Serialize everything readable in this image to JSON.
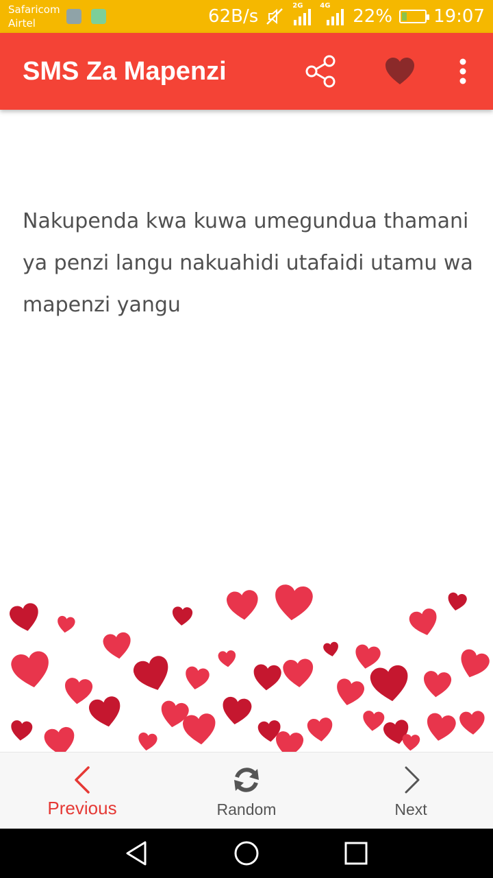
{
  "status_bar": {
    "carrier_1": "Safaricom",
    "carrier_2": "Airtel",
    "speed": "62B/s",
    "net_2g": "2G",
    "net_4g": "4G",
    "battery_percent": "22%",
    "battery_level": 0.22,
    "time": "19:07"
  },
  "app_bar": {
    "title": "SMS Za Mapenzi",
    "share_icon": "share-icon",
    "favorite_icon": "heart-icon",
    "more_icon": "more-vert-icon"
  },
  "message": {
    "text": "Nakupenda kwa kuwa umegundua thamani ya penzi langu nakuahidi utafaidi utamu wa mapenzi yangu"
  },
  "bottom_nav": {
    "previous_label": "Previous",
    "random_label": "Random",
    "next_label": "Next",
    "active": "previous"
  },
  "colors": {
    "accent": "#f44336",
    "status_bar": "#f5b800",
    "active_nav": "#e53935",
    "inactive_nav": "#555555",
    "heart": "#e8354c",
    "heart_dark": "#c5172f"
  }
}
